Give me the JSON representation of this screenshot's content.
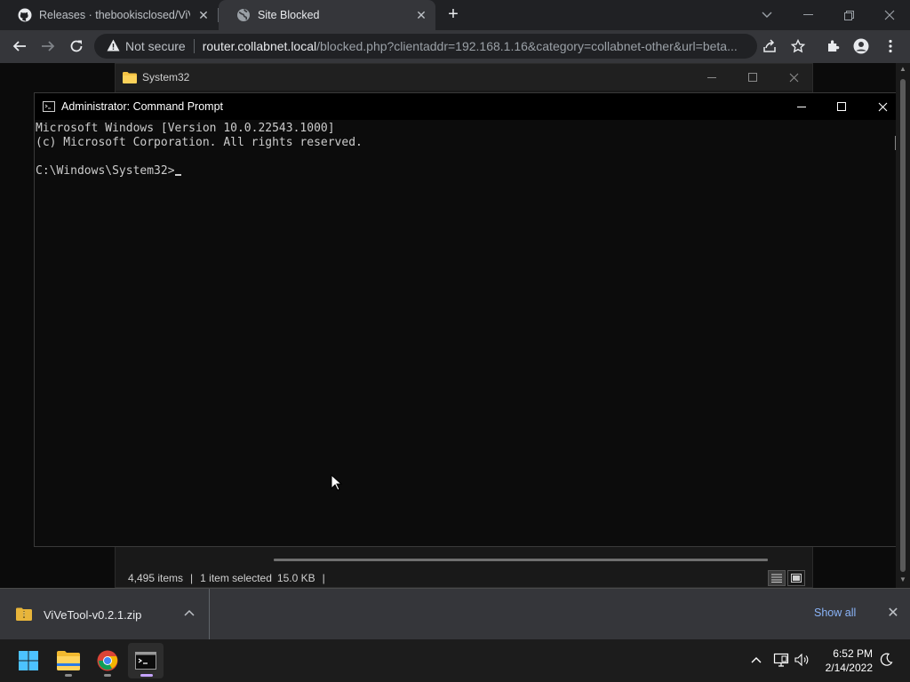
{
  "browser": {
    "tabs": [
      {
        "title": "Releases · thebookisclosed/ViVe",
        "icon": "github-icon",
        "active": false
      },
      {
        "title": "Site Blocked",
        "icon": "globe-icon",
        "active": true
      }
    ],
    "omnibox": {
      "security_label": "Not secure",
      "host": "router.collabnet.local",
      "path": "/blocked.php?clientaddr=192.168.1.16&category=collabnet-other&url=beta..."
    }
  },
  "explorer": {
    "title": "System32",
    "status": {
      "items": "4,495 items",
      "selected": "1 item selected",
      "size": "15.0 KB"
    }
  },
  "cmd": {
    "title": "Administrator: Command Prompt",
    "lines": [
      "Microsoft Windows [Version 10.0.22543.1000]",
      "(c) Microsoft Corporation. All rights reserved.",
      ""
    ],
    "prompt": "C:\\Windows\\System32>"
  },
  "downloads": {
    "file_name": "ViVeTool-v0.2.1.zip",
    "show_all_label": "Show all"
  },
  "taskbar": {
    "apps": [
      "start-icon",
      "file-explorer-icon",
      "chrome-icon",
      "terminal-icon"
    ],
    "time": "6:52 PM",
    "date": "2/14/2022"
  },
  "colors": {
    "accent_link": "#8ab4f8",
    "cmd_text": "#cccccc",
    "taskbar_active_indicator": "#c5a3ff"
  }
}
